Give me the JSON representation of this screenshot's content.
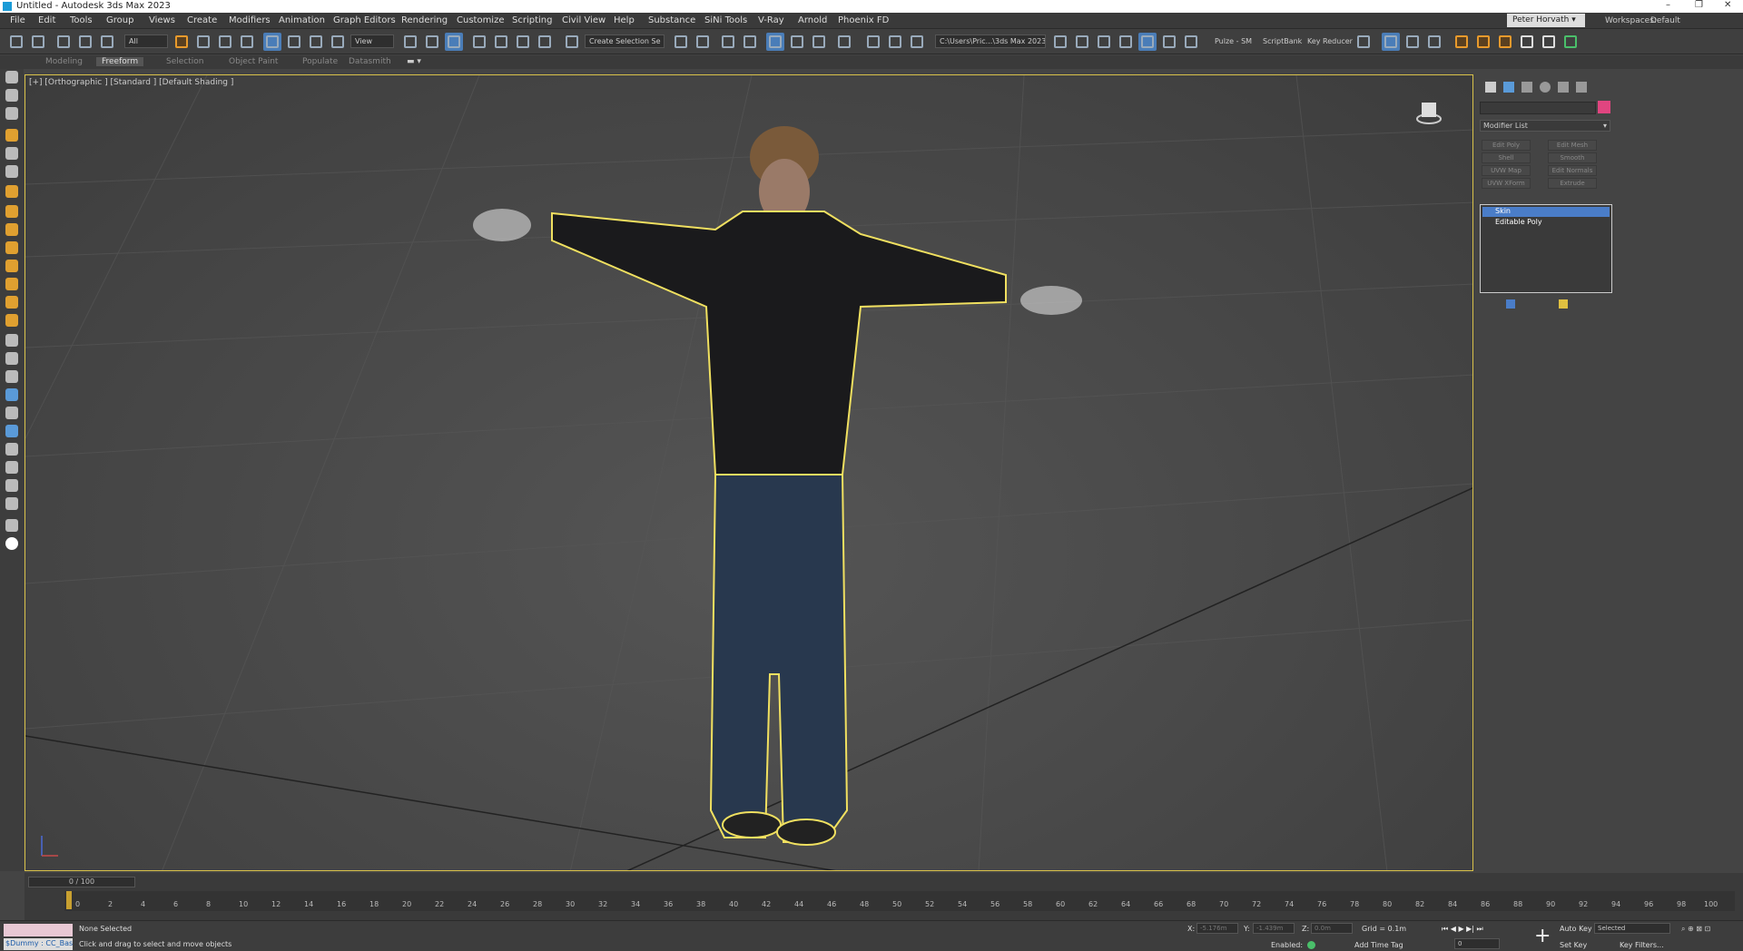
{
  "window": {
    "title": "Untitled - Autodesk 3ds Max 2023",
    "controls": [
      "–",
      "❐",
      "✕"
    ]
  },
  "menu": [
    "File",
    "Edit",
    "Tools",
    "Group",
    "Views",
    "Create",
    "Modifiers",
    "Animation",
    "Graph Editors",
    "Rendering",
    "Customize",
    "Scripting",
    "Civil View",
    "Help",
    "Substance",
    "SiNi Tools",
    "V-Ray",
    "Arnold",
    "Phoenix FD"
  ],
  "user": {
    "name": "Peter Horvath",
    "workspaces_label": "Workspaces:",
    "workspace": "Default"
  },
  "toolbar": {
    "filter": "All",
    "ref_coord": "View",
    "selection_set": "Create Selection Se",
    "project_path": "C:\\Users\\Pric...\\3ds Max 2023",
    "pulze": "Pulze - SM",
    "scriptbank": "ScriptBank",
    "key_reducer": "Key Reducer",
    "snap_angle": "3",
    "spinner": "%"
  },
  "ribbon": [
    "Modeling",
    "Freeform",
    "Selection",
    "Object Paint",
    "Populate",
    "Datasmith"
  ],
  "ribbon_active": "Freeform",
  "viewport": {
    "label": "[+] [Orthographic ] [Standard ] [Default Shading ]",
    "accent": "#d9c24a"
  },
  "command_panel": {
    "modifier_list": "Modifier List",
    "buttons": [
      "Edit Poly",
      "Edit Mesh",
      "Shell",
      "Smooth",
      "UVW Map",
      "Edit Normals",
      "UVW XForm",
      "Extrude"
    ],
    "stack": [
      "Skin",
      "Editable Poly"
    ],
    "color": "#e04580"
  },
  "timeline": {
    "slider": "0 / 100",
    "ticks": [
      "0",
      "2",
      "4",
      "6",
      "8",
      "10",
      "12",
      "14",
      "16",
      "18",
      "20",
      "22",
      "24",
      "26",
      "28",
      "30",
      "32",
      "34",
      "36",
      "38",
      "40",
      "42",
      "44",
      "46",
      "48",
      "50",
      "52",
      "54",
      "56",
      "58",
      "60",
      "62",
      "64",
      "66",
      "68",
      "70",
      "72",
      "74",
      "76",
      "78",
      "80",
      "82",
      "84",
      "86",
      "88",
      "90",
      "92",
      "94",
      "96",
      "98",
      "100"
    ]
  },
  "status": {
    "maxscript": "$Dummy : CC_Bas",
    "selection": "None Selected",
    "prompt": "Click and drag to select and move objects",
    "x_label": "X:",
    "x_value": "-5.176m",
    "y_label": "Y:",
    "y_value": "-1.439m",
    "z_label": "Z:",
    "z_value": "0.0m",
    "grid": "Grid = 0.1m",
    "enabled": "Enabled:",
    "add_time_tag": "Add Time Tag",
    "auto_key": "Auto Key",
    "set_key": "Set Key",
    "selected": "Selected",
    "key_filters": "Key Filters...",
    "frame": "0"
  }
}
